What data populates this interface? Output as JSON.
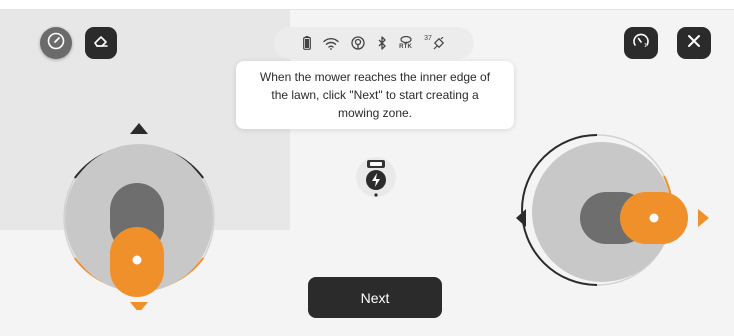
{
  "toolbar_left": {
    "compass_icon": "compass-icon",
    "eraser_icon": "eraser-icon"
  },
  "toolbar_right": {
    "speed_icon": "speedometer-icon",
    "close_icon": "close-icon"
  },
  "status": {
    "rtk_label": "RTK",
    "satellite_count": "37",
    "icons": [
      "battery-icon",
      "wifi-icon",
      "signal-icon",
      "bluetooth-icon",
      "rtk-icon",
      "satellite-icon"
    ]
  },
  "tooltip": {
    "text": "When the mower reaches the inner edge of the lawn, click \"Next\" to start creating a mowing zone."
  },
  "actions": {
    "next_label": "Next"
  },
  "colors": {
    "accent": "#f0902a",
    "dark": "#2b2b2b",
    "background": "#f4f4f4",
    "map": "#e7e7e7"
  }
}
